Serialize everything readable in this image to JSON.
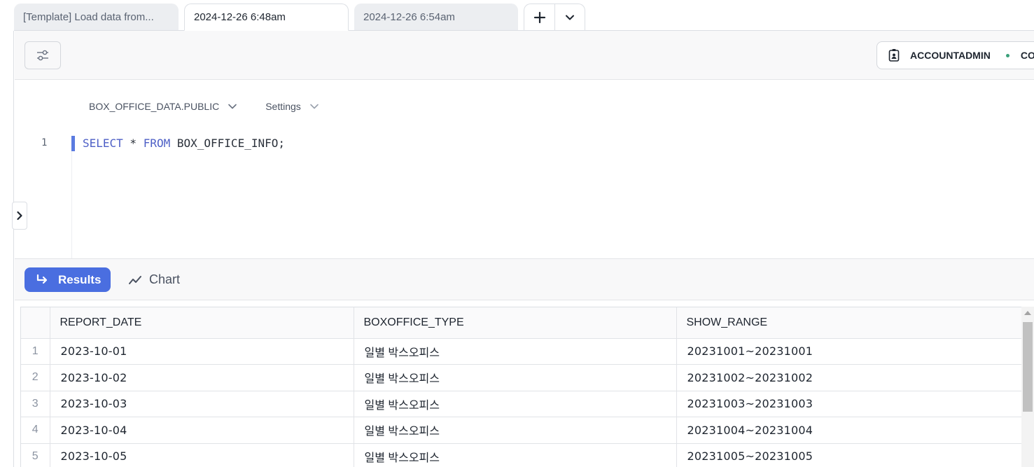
{
  "tabs": [
    {
      "label": "[Template] Load data from..."
    },
    {
      "label": "2024-12-26 6:48am"
    },
    {
      "label": "2024-12-26 6:54am"
    }
  ],
  "tab_actions": {
    "add_icon": "plus-icon",
    "menu_icon": "chevron-down-icon"
  },
  "toolbar": {
    "filter_icon": "sliders-icon",
    "role_label": "ACCOUNTADMIN",
    "warehouse_label_partial": "CO"
  },
  "editor": {
    "context": {
      "database_schema": "BOX_OFFICE_DATA.PUBLIC",
      "settings": "Settings"
    },
    "line_number": "1",
    "code": {
      "kw1": "SELECT",
      "star": " * ",
      "kw2": "FROM",
      "rest": " BOX_OFFICE_INFO;"
    }
  },
  "results": {
    "results_label": "Results",
    "chart_label": "Chart",
    "columns": [
      "REPORT_DATE",
      "BOXOFFICE_TYPE",
      "SHOW_RANGE"
    ],
    "rows": [
      {
        "n": "1",
        "date": "2023-10-01",
        "type": "일별 박스오피스",
        "range": "20231001~20231001"
      },
      {
        "n": "2",
        "date": "2023-10-02",
        "type": "일별 박스오피스",
        "range": "20231002~20231002"
      },
      {
        "n": "3",
        "date": "2023-10-03",
        "type": "일별 박스오피스",
        "range": "20231003~20231003"
      },
      {
        "n": "4",
        "date": "2023-10-04",
        "type": "일별 박스오피스",
        "range": "20231004~20231004"
      },
      {
        "n": "5",
        "date": "2023-10-05",
        "type": "일별 박스오피스",
        "range": "20231005~20231005"
      }
    ]
  },
  "colors": {
    "accent": "#4a6ee0",
    "keyword": "#4d5fc6",
    "status_dot": "#3aa07a"
  }
}
